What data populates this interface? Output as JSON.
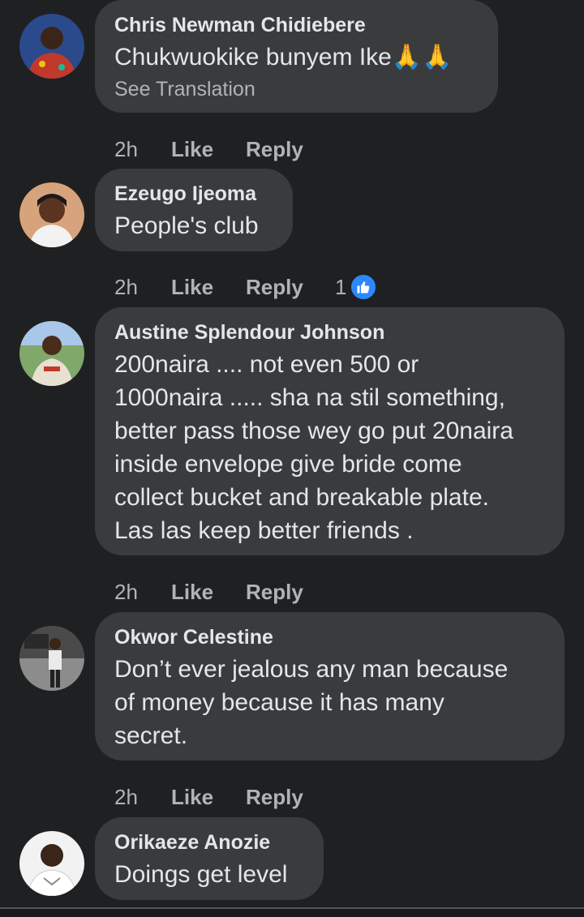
{
  "comments": [
    {
      "author": "Chris Newman Chidiebere",
      "body": "Chukwuokike bunyem Ike🙏🙏",
      "translation": "See Translation",
      "time": "2h",
      "like": "Like",
      "reply": "Reply"
    },
    {
      "author": "Ezeugo Ijeoma",
      "body": "People's club",
      "time": "2h",
      "like": "Like",
      "reply": "Reply",
      "reaction_count": "1",
      "reaction_icon": "like-thumb-icon"
    },
    {
      "author": "Austine Splendour Johnson",
      "body_lines": [
        "200naira .... not even 500 or",
        "1000naira ..... sha na stil something,",
        "better pass those wey go put 20naira",
        "inside envelope give bride come",
        "collect bucket and breakable plate.",
        "Las las keep better friends ."
      ],
      "time": "2h",
      "like": "Like",
      "reply": "Reply"
    },
    {
      "author": "Okwor Celestine",
      "body_lines": [
        "Don’t ever jealous any man because",
        "of money because it has many",
        "secret."
      ],
      "time": "2h",
      "like": "Like",
      "reply": "Reply"
    },
    {
      "author": "Orikaeze Anozie",
      "body": "Doings get level"
    }
  ],
  "colors": {
    "background": "#1f2022",
    "bubble": "#3a3b3d",
    "text": "#e4e6eb",
    "secondary": "#b0b3b8",
    "like_blue": "#2d88ff"
  }
}
